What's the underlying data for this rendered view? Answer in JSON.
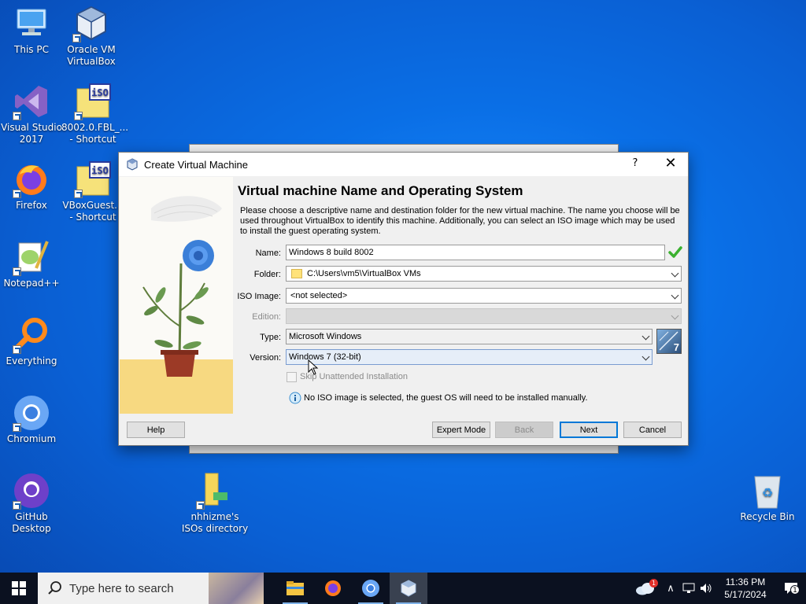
{
  "desktop": {
    "icons": [
      {
        "label": "This PC"
      },
      {
        "label": "Oracle VM VirtualBox"
      },
      {
        "label": "Visual Studio 2017"
      },
      {
        "label": "8002.0.FBL_... - Shortcut"
      },
      {
        "label": "Firefox"
      },
      {
        "label": "VBoxGuest... - Shortcut"
      },
      {
        "label": "Notepad++"
      },
      {
        "label": "Everything"
      },
      {
        "label": "Chromium"
      },
      {
        "label": "GitHub Desktop"
      },
      {
        "label": "nhhizme's ISOs directory"
      },
      {
        "label": "Recycle Bin"
      }
    ],
    "iso_badge": "iSO"
  },
  "dialog": {
    "title": "Create Virtual Machine",
    "help_glyph": "?",
    "close_glyph": "✕",
    "heading": "Virtual machine Name and Operating System",
    "description": "Please choose a descriptive name and destination folder for the new virtual machine. The name you choose will be used throughout VirtualBox to identify this machine. Additionally, you can select an ISO image which may be used to install the guest operating system.",
    "name_label": "Name:",
    "name_value": "Windows 8 build 8002",
    "folder_label": "Folder:",
    "folder_value": "C:\\Users\\vm5\\VirtualBox VMs",
    "iso_label": "ISO Image:",
    "iso_value": "<not selected>",
    "edition_label": "Edition:",
    "edition_value": "",
    "type_label": "Type:",
    "type_value": "Microsoft Windows",
    "version_label": "Version:",
    "version_value": "Windows 7 (32-bit)",
    "os_badge": "7",
    "skip_unattended_label": "Skip Unattended Installation",
    "skip_unattended_checked": false,
    "info_text": "No ISO image is selected, the guest OS will need to be installed manually.",
    "buttons": {
      "help": "Help",
      "expert": "Expert Mode",
      "back": "Back",
      "next": "Next",
      "cancel": "Cancel"
    }
  },
  "taskbar": {
    "search_placeholder": "Type here to search",
    "weather_badge": "1",
    "time": "11:36 PM",
    "date": "5/17/2024",
    "notification_count": "1"
  },
  "colors": {
    "desktop_blue": "#0a6fe6",
    "taskbar": "#0b1120",
    "accent": "#0078d7",
    "check_green": "#3bb12f"
  }
}
